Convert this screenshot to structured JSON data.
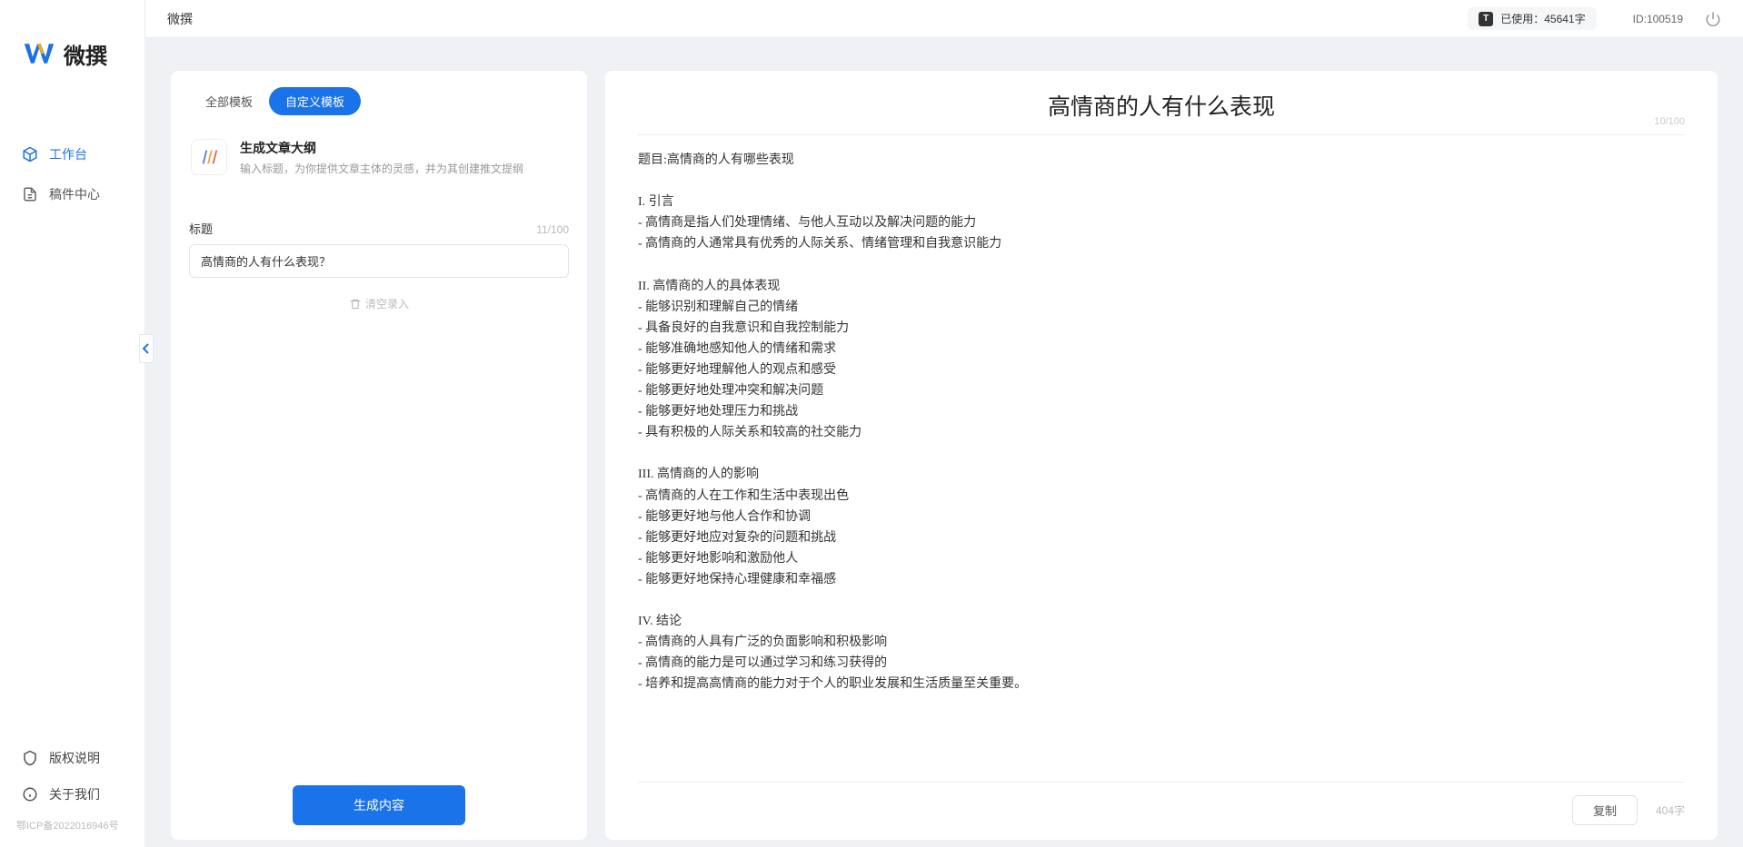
{
  "app": {
    "logo_text": "微撰",
    "topbar_title": "微撰",
    "usage_prefix": "已使用：",
    "usage_value": "45641字",
    "user_id": "ID:100519"
  },
  "sidebar": {
    "nav": [
      {
        "label": "工作台",
        "active": true
      },
      {
        "label": "稿件中心",
        "active": false
      }
    ],
    "bottom": [
      {
        "label": "版权说明"
      },
      {
        "label": "关于我们"
      }
    ],
    "icp": "鄂ICP备2022016946号"
  },
  "left": {
    "tabs": [
      {
        "label": "全部模板",
        "active": false
      },
      {
        "label": "自定义模板",
        "active": true
      }
    ],
    "template": {
      "title": "生成文章大纲",
      "desc": "输入标题，为你提供文章主体的灵感，并为其创建推文提纲"
    },
    "form": {
      "label": "标题",
      "char_count": "11/100",
      "input_value": "高情商的人有什么表现？"
    },
    "clear_label": "清空录入",
    "generate_label": "生成内容"
  },
  "right": {
    "title": "高情商的人有什么表现",
    "title_count": "10/100",
    "content": "题目:高情商的人有哪些表现\n\nI. 引言\n- 高情商是指人们处理情绪、与他人互动以及解决问题的能力\n- 高情商的人通常具有优秀的人际关系、情绪管理和自我意识能力\n\nII. 高情商的人的具体表现\n- 能够识别和理解自己的情绪\n- 具备良好的自我意识和自我控制能力\n- 能够准确地感知他人的情绪和需求\n- 能够更好地理解他人的观点和感受\n- 能够更好地处理冲突和解决问题\n- 能够更好地处理压力和挑战\n- 具有积极的人际关系和较高的社交能力\n\nIII. 高情商的人的影响\n- 高情商的人在工作和生活中表现出色\n- 能够更好地与他人合作和协调\n- 能够更好地应对复杂的问题和挑战\n- 能够更好地影响和激励他人\n- 能够更好地保持心理健康和幸福感\n\nIV. 结论\n- 高情商的人具有广泛的负面影响和积极影响\n- 高情商的能力是可以通过学习和练习获得的\n- 培养和提高高情商的能力对于个人的职业发展和生活质量至关重要。",
    "copy_label": "复制",
    "word_count": "404字"
  }
}
